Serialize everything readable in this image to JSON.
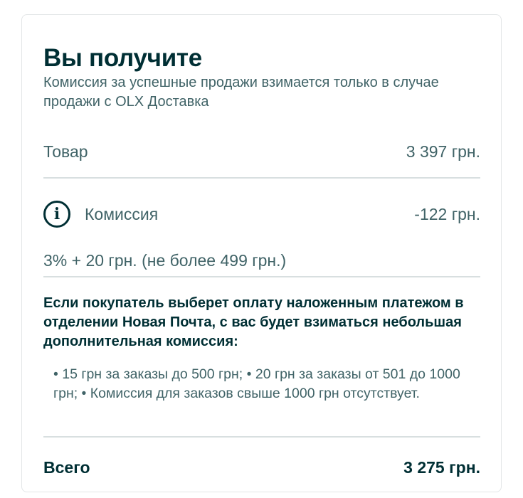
{
  "card": {
    "title": "Вы получите",
    "subtitle": "Комиссия за успешные продажи взимается только в случае продажи с OLX Доставка",
    "goods": {
      "label": "Товар",
      "value": "3 397 грн."
    },
    "commission": {
      "icon": "info-icon",
      "label": "Комиссия",
      "value": "-122 грн.",
      "formula": "3% + 20 грн. (не более 499 грн.)"
    },
    "notice": "Если покупатель выберет оплату наложенным платежом в отделении Новая Почта, с вас будет взиматься небольшая дополнительная комиссия:",
    "bullets": "• 15 грн за заказы до 500 грн; • 20 грн за заказы от 501 до 1000 грн; • Комиссия для заказов свыше 1000 грн отсутствует.",
    "total": {
      "label": "Всего",
      "value": "3 275 грн."
    }
  },
  "colors": {
    "text_dark": "#002f34",
    "text_muted": "#406367",
    "divider": "#d8dfe0",
    "card_border": "#e3e6e7"
  }
}
